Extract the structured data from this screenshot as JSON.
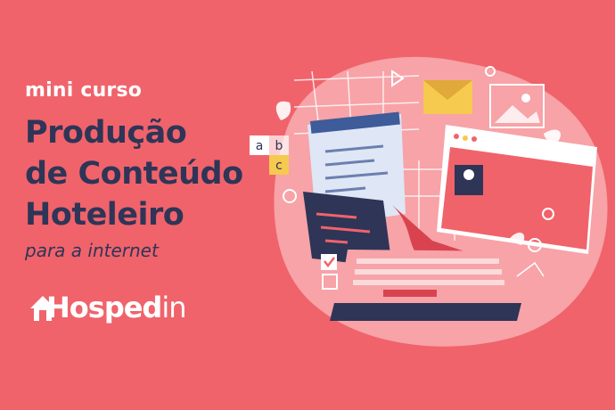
{
  "banner": {
    "eyebrow": "mini curso",
    "title_lines": [
      "Produção",
      "de Conteúdo",
      "Hoteleiro"
    ],
    "subtitle": "para a internet",
    "logo": {
      "text_main": "Hosped",
      "text_suffix": "in"
    },
    "illustration": {
      "letter_tiles": [
        "a",
        "b",
        "c"
      ]
    }
  },
  "colors": {
    "background": "#f0636b",
    "title": "#2e3557",
    "accent_light": "#f7a3a8",
    "yellow": "#f6c94f",
    "white": "#ffffff"
  }
}
